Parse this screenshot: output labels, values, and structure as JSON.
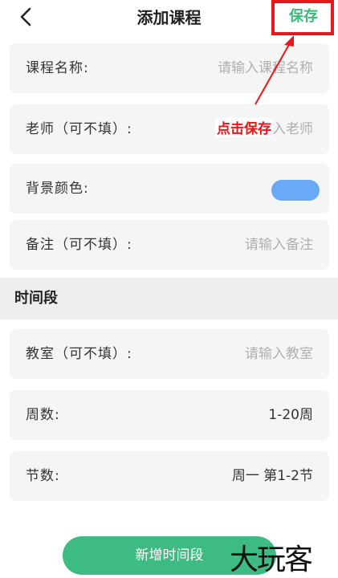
{
  "header": {
    "title": "添加课程",
    "save_label": "保存",
    "back_icon": "chevron-left-icon"
  },
  "annotation": {
    "text": "点击保存",
    "color": "#e8171c"
  },
  "course_fields": {
    "name": {
      "label": "课程名称:",
      "placeholder": "请输入课程名称",
      "value": ""
    },
    "teacher": {
      "label": "老师（可不填）:",
      "placeholder": "请输入老师",
      "value": ""
    },
    "bg_color": {
      "label": "背景颜色:",
      "color": "#6aa9f5"
    },
    "note": {
      "label": "备注（可不填）:",
      "placeholder": "请输入备注",
      "value": ""
    }
  },
  "time_section": {
    "title": "时间段",
    "classroom": {
      "label": "教室（可不填）:",
      "placeholder": "请输入教室",
      "value": ""
    },
    "weeks": {
      "label": "周数:",
      "value": "1-20周"
    },
    "sessions": {
      "label": "节数:",
      "value": "周一 第1-2节"
    }
  },
  "footer": {
    "add_time_label": "新增时间段",
    "watermark": "大玩客"
  },
  "colors": {
    "accent_green": "#3dbb82",
    "save_green": "#3cb878",
    "highlight_red": "#e8171c",
    "card_bg": "#f5f5f5"
  }
}
